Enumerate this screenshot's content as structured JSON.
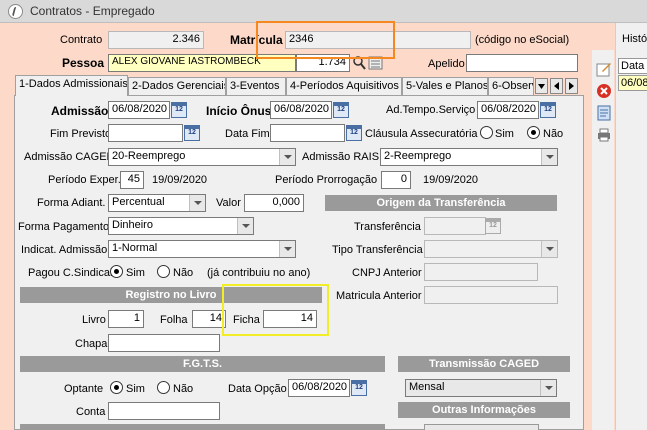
{
  "window": {
    "title": "Contratos - Empregado"
  },
  "header": {
    "contrato_label": "Contrato",
    "contrato_value": "2.346",
    "matricula_label": "Matrícula",
    "matricula_value": "2346",
    "matricula_note": "(código no eSocial)",
    "pessoa_label": "Pessoa",
    "pessoa_value": "ALEX GIOVANE IASTROMBECK",
    "pessoa_code": "1.734",
    "apelido_label": "Apelido",
    "apelido_value": ""
  },
  "tabs": [
    {
      "label": "1-Dados Admissionais"
    },
    {
      "label": "2-Dados Gerenciais"
    },
    {
      "label": "3-Eventos"
    },
    {
      "label": "4-Períodos Aquisitivos"
    },
    {
      "label": "5-Vales e Planos"
    },
    {
      "label": "6-Observ"
    }
  ],
  "form": {
    "admissao_label": "Admissão",
    "admissao_value": "06/08/2020",
    "inicio_onus_label": "Início Ônus",
    "inicio_onus_value": "06/08/2020",
    "ad_tempo_label": "Ad.Tempo.Serviço",
    "ad_tempo_value": "06/08/2020",
    "fim_previsto_label": "Fim Previsto",
    "fim_previsto_value": "",
    "data_fim_label": "Data Fim",
    "data_fim_value": "",
    "clausula_label": "Cláusula Assecuratória",
    "clausula_sim": "Sim",
    "clausula_nao": "Não",
    "adm_caged_label": "Admissão CAGED",
    "adm_caged_value": "20-Reemprego",
    "adm_rais_label": "Admissão RAIS",
    "adm_rais_value": "2-Reemprego",
    "periodo_exper_label": "Período Exper.",
    "periodo_exper_value": "45",
    "periodo_exper_date": "19/09/2020",
    "periodo_prorrog_label": "Período Prorrogação",
    "periodo_prorrog_value": "0",
    "periodo_prorrog_date": "19/09/2020",
    "forma_adiant_label": "Forma Adiant.",
    "forma_adiant_value": "Percentual",
    "valor_label": "Valor",
    "valor_value": "0,000",
    "forma_pag_label": "Forma Pagamento",
    "forma_pag_value": "Dinheiro",
    "indicat_label": "Indicat. Admissão",
    "indicat_value": "1-Normal",
    "pagou_label": "Pagou C.Sindical",
    "pagou_sim": "Sim",
    "pagou_nao": "Não",
    "pagou_note": "(já contribuiu no ano)",
    "livro_section": "Registro no Livro",
    "livro_label": "Livro",
    "livro_value": "1",
    "folha_label": "Folha",
    "folha_value": "14",
    "ficha_label": "Ficha",
    "ficha_value": "14",
    "chapa_label": "Chapa",
    "chapa_value": "",
    "fgts_section": "F.G.T.S.",
    "optante_label": "Optante",
    "optante_sim": "Sim",
    "optante_nao": "Não",
    "data_opcao_label": "Data Opção",
    "data_opcao_value": "06/08/2020",
    "conta_label": "Conta",
    "conta_value": ""
  },
  "transfer": {
    "section": "Origem da Transferência",
    "transferencia_label": "Transferência",
    "tipo_label": "Tipo Transferência",
    "cnpj_label": "CNPJ Anterior",
    "matricula_ant_label": "Matricula Anterior"
  },
  "caged": {
    "section": "Transmissão CAGED",
    "value": "Mensal",
    "outras_section": "Outras Informações"
  },
  "history": {
    "title": "Histó",
    "col_label": "Data",
    "row_value": "06/08"
  }
}
